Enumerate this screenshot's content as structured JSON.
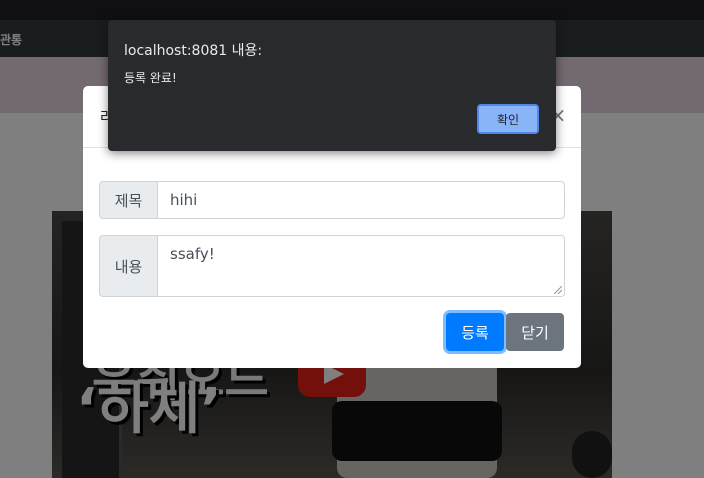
{
  "navbar": {
    "brand_text": "관통"
  },
  "video": {
    "thumbnail_text_line1": "우취오드",
    "thumbnail_text_line2": "‘하체’"
  },
  "modal": {
    "title": "라",
    "close_symbol": "×",
    "fields": {
      "title_label": "제목",
      "title_value": "hihi",
      "content_label": "내용",
      "content_value": "ssafy!"
    },
    "buttons": {
      "register_label": "등록",
      "close_label": "닫기"
    }
  },
  "alert": {
    "origin": "localhost:8081 내용:",
    "message": "등록 완료!",
    "ok_label": "확인"
  },
  "colors": {
    "primary": "#007bff",
    "secondary": "#6c757d",
    "alert_bg": "#292a2d",
    "alert_button": "#8ab4f8"
  }
}
